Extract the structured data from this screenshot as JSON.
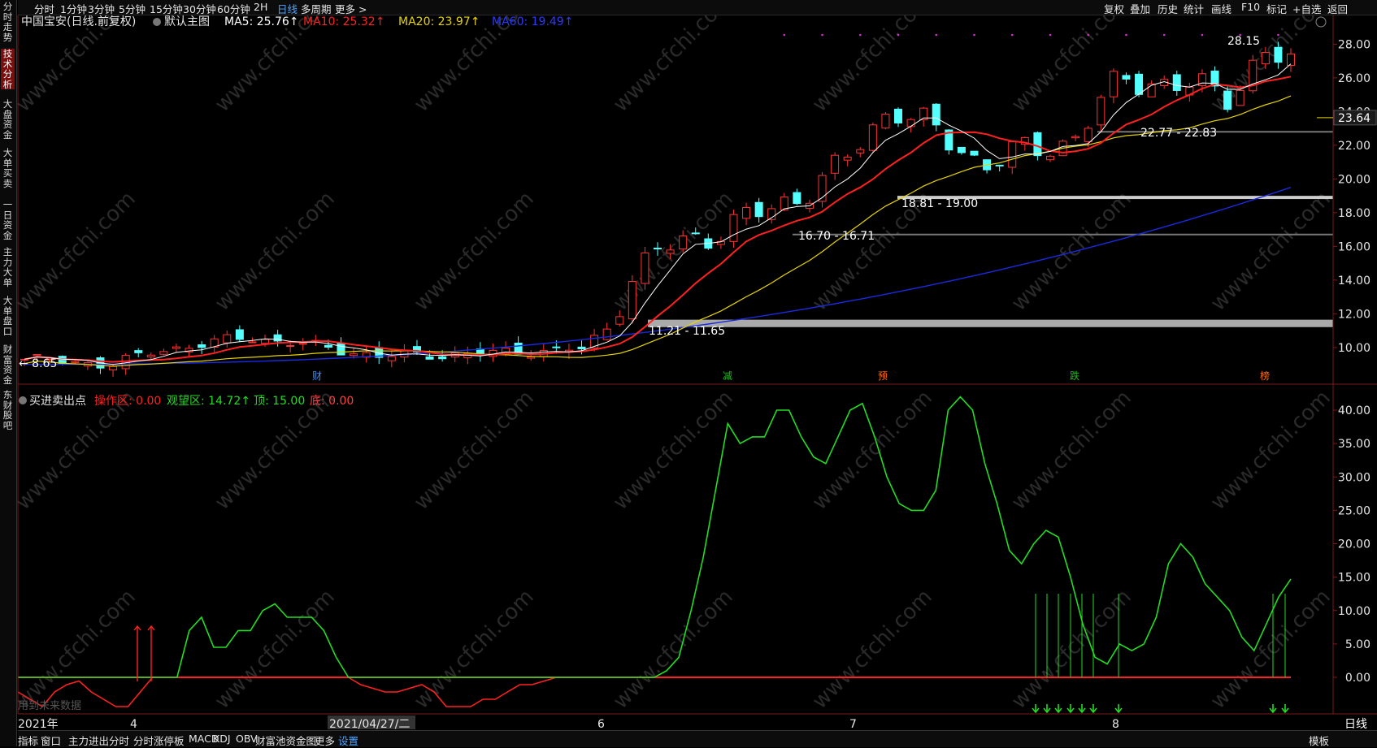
{
  "top_toolbar": {
    "left_items": [
      "分时",
      "1分钟",
      "3分钟",
      "5分钟",
      "15分钟",
      "30分钟",
      "60分钟",
      "2H",
      "日线",
      "多周期",
      "更多 >"
    ],
    "active": "日线",
    "right_items": [
      "复权",
      "叠加",
      "历史",
      "统计",
      "画线",
      "F10",
      "标记",
      "+自选",
      "返回"
    ]
  },
  "left_tabs": [
    "分时走势",
    "技术分析",
    "大盘资金",
    "大单买卖",
    "一日资金",
    "主力大单",
    "大单盘口",
    "财富资金",
    "东财股吧"
  ],
  "left_active": "技术分析",
  "main_header": {
    "title": "中国宝安(日线.前复权)",
    "template": "默认主图",
    "ma5": "MA5: 25.76↑",
    "ma10": "MA10: 25.32↑",
    "ma20": "MA20: 23.97↑",
    "ma60": "MA60: 19.49↑"
  },
  "price_axis": [
    "28.00",
    "26.00",
    "24.00",
    "22.00",
    "20.00",
    "18.00",
    "16.00",
    "14.00",
    "12.00",
    "10.00"
  ],
  "current_price": "23.64",
  "annotations": {
    "high": "28.15",
    "low": "← 8.65",
    "gap1": "11.21 - 11.65",
    "gap2": "16.70 - 16.71",
    "gap3": "18.81 - 19.00",
    "gap4": "22.77 - 22.83"
  },
  "event_markers": [
    "财",
    "减",
    "预",
    "跌",
    "榜"
  ],
  "sub_header": {
    "title": "买进卖出点",
    "op": "操作区: 0.00",
    "watch": "观望区: 14.72↑",
    "top": "顶: 15.00",
    "bottom": "底: 0.00"
  },
  "sub_axis": [
    "40.00",
    "35.00",
    "30.00",
    "25.00",
    "20.00",
    "15.00",
    "10.00",
    "5.00",
    "0.00"
  ],
  "future_note": "用到未来数据",
  "date_axis": [
    "2021年",
    "4",
    "2021/04/27/二",
    "6",
    "7",
    "8"
  ],
  "period_label": "日线",
  "bottom_tabs": [
    "指标",
    "窗口",
    "主力进出分时",
    "分时涨停板",
    "MACD",
    "KDJ",
    "OBV",
    "财富池资金图",
    "更多",
    "设置"
  ],
  "bottom_right": "模板",
  "watermark": "www.cfchi.com",
  "colors": {
    "up": "#ff3232",
    "down": "#54ffff",
    "ma5": "#ffffff",
    "ma10": "#ff2020",
    "ma20": "#e6d400",
    "ma60": "#1a2adf",
    "green": "#22dd22",
    "red": "#ff2020"
  },
  "chart_data": [
    {
      "type": "candlestick",
      "title": "中国宝安(日线.前复权)",
      "ylim": [
        8.5,
        28.5
      ],
      "x": [
        "2021-03",
        "2021-04",
        "2021-05",
        "2021-06",
        "2021-07",
        "2021-08"
      ],
      "high": 28.15,
      "low": 8.65,
      "ma_last": {
        "MA5": 25.76,
        "MA10": 25.32,
        "MA20": 23.97,
        "MA60": 19.49
      },
      "support_bands": [
        [
          11.21,
          11.65
        ],
        [
          16.7,
          16.71
        ],
        [
          18.81,
          19.0
        ],
        [
          22.77,
          22.83
        ]
      ]
    },
    {
      "type": "line",
      "title": "买进卖出点",
      "ylim": [
        0,
        42
      ],
      "series": [
        {
          "name": "观望区",
          "values": [
            0,
            0,
            0,
            0,
            0,
            0,
            0,
            0,
            0,
            0,
            0,
            0,
            0,
            0,
            7,
            9,
            4.5,
            4.5,
            7,
            7,
            10,
            11,
            9,
            9,
            9,
            7,
            3,
            0,
            0,
            0,
            0,
            0,
            0,
            0,
            0,
            0,
            0,
            0,
            0,
            0,
            0,
            0,
            0,
            0,
            0,
            0,
            0,
            0,
            0,
            0,
            0,
            0,
            0,
            1,
            3,
            10,
            18,
            28,
            38,
            35,
            36,
            36,
            40,
            40,
            36,
            33,
            32,
            36,
            40,
            41,
            36,
            30,
            26,
            25,
            25,
            28,
            40,
            42,
            40,
            32,
            26,
            19,
            17,
            20,
            22,
            21,
            15,
            8,
            3,
            2,
            5,
            4,
            5,
            9,
            17,
            20,
            18,
            14,
            12,
            10,
            6,
            4,
            8,
            12,
            14.72
          ]
        },
        {
          "name": "操作区",
          "values": [
            -2,
            -3,
            -4,
            -2,
            -1,
            -0.5,
            -2,
            -3,
            -4,
            -4,
            -2,
            0,
            0,
            0,
            0,
            0,
            0,
            0,
            0,
            0,
            0,
            0,
            0,
            0,
            0,
            0,
            0,
            0,
            -1,
            -1.5,
            -2,
            -2,
            -1.5,
            -1,
            -2,
            -4,
            -4,
            -4,
            -3,
            -3,
            -2,
            -1,
            -1,
            -0.5,
            0,
            0,
            0,
            0,
            0,
            0,
            0,
            0,
            0,
            0,
            0,
            0,
            0,
            0,
            0,
            0,
            0,
            0,
            0,
            0,
            0,
            0,
            0,
            0,
            0,
            0,
            0,
            0,
            0,
            0,
            0,
            0,
            0,
            0,
            0,
            0,
            0,
            0,
            0,
            0,
            0,
            0,
            0,
            0,
            0,
            0,
            0,
            0,
            0,
            0,
            0,
            0,
            0,
            0,
            0,
            0,
            0,
            0,
            0,
            0,
            0
          ]
        }
      ]
    }
  ]
}
